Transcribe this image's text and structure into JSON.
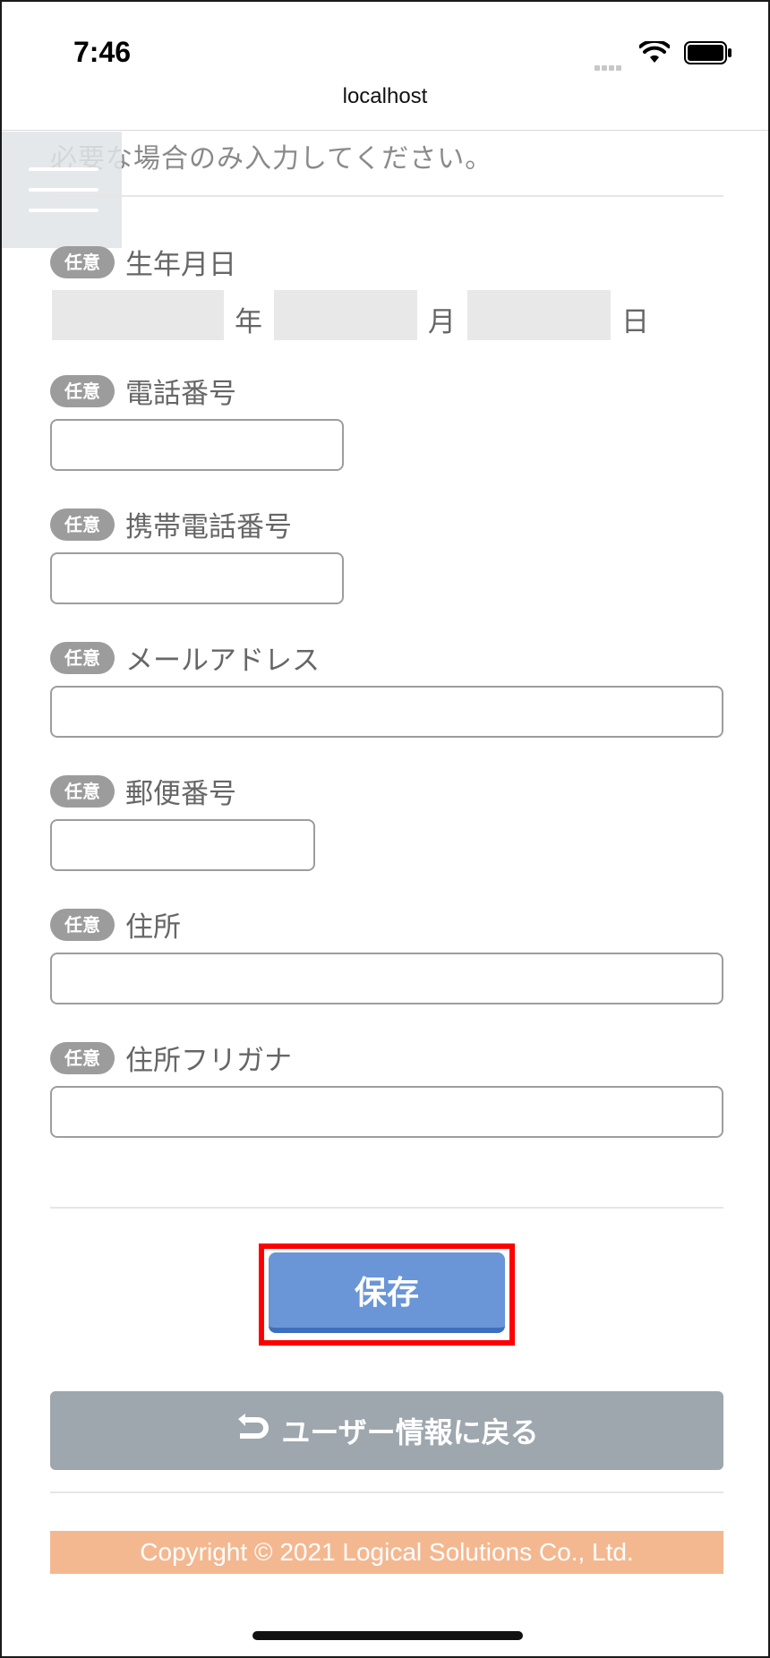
{
  "status_bar": {
    "time": "7:46"
  },
  "browser": {
    "url": "localhost"
  },
  "intro": {
    "text": "必要な場合のみ入力してください。"
  },
  "badge_text": "任意",
  "fields": {
    "birthdate": {
      "label": "生年月日",
      "year_unit": "年",
      "month_unit": "月",
      "day_unit": "日"
    },
    "phone": {
      "label": "電話番号"
    },
    "mobile": {
      "label": "携帯電話番号"
    },
    "email": {
      "label": "メールアドレス"
    },
    "postal": {
      "label": "郵便番号"
    },
    "address": {
      "label": "住所"
    },
    "address_kana": {
      "label": "住所フリガナ"
    }
  },
  "buttons": {
    "save": "保存",
    "back": "ユーザー情報に戻る"
  },
  "footer": {
    "copyright": "Copyright © 2021 Logical Solutions Co., Ltd."
  },
  "colors": {
    "save_button": "#6a95d7",
    "back_button": "#9ea7ad",
    "footer_bg": "#f4b891",
    "badge_bg": "#9c9c9c",
    "highlight": "#ff0000"
  }
}
